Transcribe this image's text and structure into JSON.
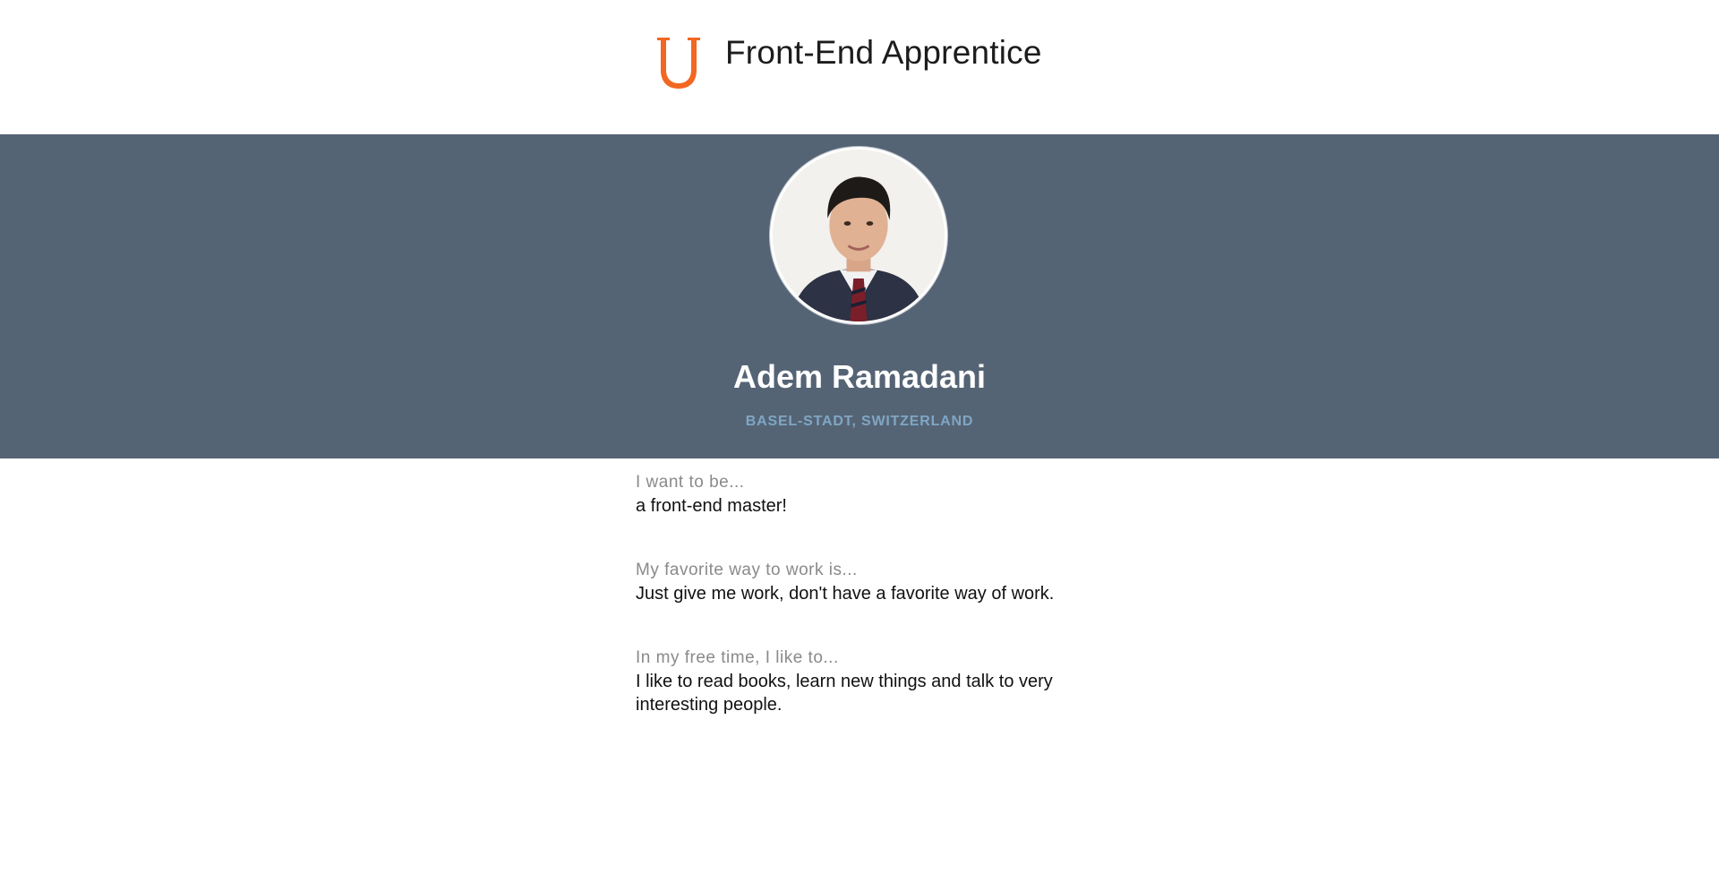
{
  "header": {
    "logo_icon": "udacity-u-logo-icon",
    "logo_color": "#f26722",
    "title": "Front-End Apprentice"
  },
  "profile": {
    "avatar": "profile-photo",
    "name": "Adem Ramadani",
    "location": "BASEL-STADT, SWITZERLAND",
    "band_color": "#556475",
    "location_color": "#7fa6c4"
  },
  "answers": [
    {
      "question": "I want to be...",
      "answer": "a front-end master!"
    },
    {
      "question": "My favorite way to work is...",
      "answer": "Just give me work, don't have a favorite way of work."
    },
    {
      "question": "In my free time, I like to...",
      "answer": "I like to read books, learn new things and talk to very interesting people."
    }
  ]
}
